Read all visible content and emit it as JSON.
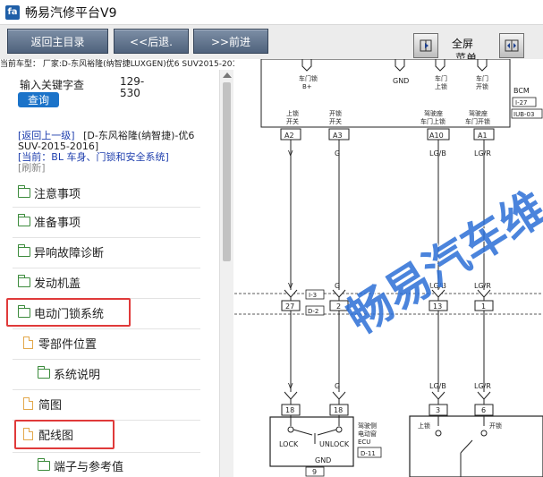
{
  "app": {
    "title": "畅易汽修平台V9",
    "logo_text": "fa"
  },
  "toolbar": {
    "home_label": "返回主目录",
    "back_label": "<<后退.",
    "forward_label": ">>前进",
    "fullscreen_label": "全屏",
    "menu_label": "菜单"
  },
  "car_info": "当前车型： 厂家:D-东风裕隆(纳智捷LUXGEN)优6 SUV2015-2016",
  "search": {
    "placeholder": "输入关键字查",
    "range": "129-530",
    "query_label": "查询"
  },
  "nav": {
    "up_link": "[返回上一级]",
    "model_line": "[D-东风裕隆(纳智捷)-优6 SUV-2015-2016]",
    "current_line": "[当前：BL 车身、门锁和安全系统]",
    "refresh_link": "[刷新]"
  },
  "tree": [
    {
      "label": "注意事项",
      "icon": "folder-icon"
    },
    {
      "label": "准备事项",
      "icon": "folder-icon"
    },
    {
      "label": "异响故障诊断",
      "icon": "folder-icon"
    },
    {
      "label": "发动机盖",
      "icon": "folder-icon"
    },
    {
      "label": "电动门锁系统",
      "icon": "folder-open-icon",
      "highlighted": true
    },
    {
      "label": "零部件位置",
      "icon": "file-icon"
    },
    {
      "label": "系统说明",
      "icon": "folder-icon"
    },
    {
      "label": "简图",
      "icon": "file-icon"
    },
    {
      "label": "配线图",
      "icon": "file-icon",
      "highlighted": true
    },
    {
      "label": "端子与参考值",
      "icon": "folder-icon"
    }
  ],
  "diagram": {
    "watermark": "畅易汽车维",
    "bcm_label": "BCM",
    "bcm_refs": [
      "I-27",
      "IUB-03"
    ],
    "top_labels": {
      "door_lock_b": "车门锁",
      "b_plus": "B+",
      "gnd": "GND",
      "door_up": "车门",
      "door_up2": "上锁",
      "door_open": "车门",
      "door_open2": "开锁"
    },
    "switch_labels": {
      "lock_sw": "上锁",
      "lock_sw2": "开关",
      "unlock_sw": "开锁",
      "unlock_sw2": "开关",
      "drv_lock": "驾驶座",
      "drv_lock2": "车门上锁",
      "drv_unlock": "驾驶座",
      "drv_unlock2": "车门开锁"
    },
    "pins_top": [
      "A2",
      "A3",
      "A10",
      "A1"
    ],
    "wires": [
      "V",
      "G",
      "LG/B",
      "LG/R"
    ],
    "connector_refs": [
      "I-3",
      "D-2"
    ],
    "pins_mid": [
      "27",
      "2",
      "13",
      "1"
    ],
    "pins_low": [
      "18",
      "18",
      "3",
      "6"
    ],
    "actuator": {
      "lock": "LOCK",
      "unlock": "UNLOCK",
      "gnd": "GND",
      "name": "驾驶侧",
      "name2": "电动窗",
      "name3": "ECU",
      "ref": "D-11",
      "pin": "9"
    },
    "switch_box": {
      "lock": "上锁",
      "unlock": "开锁"
    }
  }
}
